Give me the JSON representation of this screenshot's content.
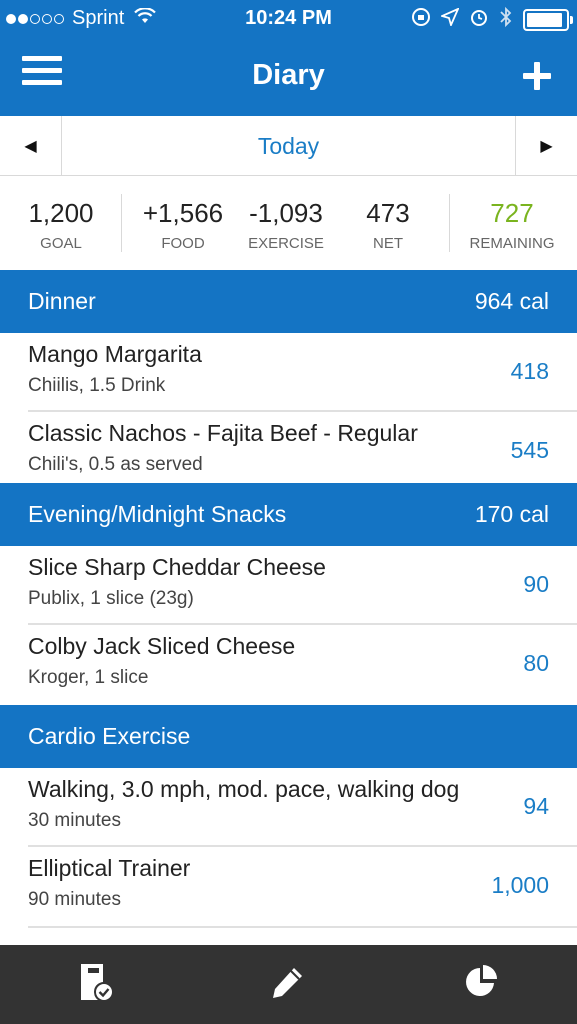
{
  "status_bar": {
    "carrier": "Sprint",
    "time": "10:24 PM"
  },
  "nav": {
    "title": "Diary",
    "menu_icon": "hamburger-menu-icon",
    "add_icon": "plus-icon"
  },
  "date_bar": {
    "prev": "◀",
    "label": "Today",
    "next": "▶"
  },
  "summary": {
    "goal": {
      "value": "1,200",
      "label": "GOAL"
    },
    "food": {
      "value": "+1,566",
      "label": "FOOD"
    },
    "exercise": {
      "value": "-1,093",
      "label": "EXERCISE"
    },
    "net": {
      "value": "473",
      "label": "NET"
    },
    "remaining": {
      "value": "727",
      "label": "REMAINING",
      "color": "#7ab41f"
    }
  },
  "sections": [
    {
      "name": "Dinner",
      "calories": "964 cal",
      "entries": [
        {
          "title": "Mango Margarita",
          "subtitle": "Chiilis, 1.5 Drink",
          "value": "418"
        },
        {
          "title": "Classic Nachos - Fajita Beef - Regular",
          "subtitle": "Chili's, 0.5 as served",
          "value": "545"
        }
      ]
    },
    {
      "name": "Evening/Midnight Snacks",
      "calories": "170 cal",
      "entries": [
        {
          "title": "Slice Sharp Cheddar Cheese",
          "subtitle": "Publix, 1 slice (23g)",
          "value": "90"
        },
        {
          "title": "Colby Jack Sliced Cheese",
          "subtitle": "Kroger, 1 slice",
          "value": "80"
        }
      ]
    },
    {
      "name": "Cardio Exercise",
      "calories": "",
      "entries": [
        {
          "title": "Walking, 3.0 mph, mod. pace, walking dog",
          "subtitle": "30 minutes",
          "value": "94"
        },
        {
          "title": "Elliptical Trainer",
          "subtitle": "90 minutes",
          "value": "1,000"
        }
      ]
    }
  ],
  "tab_bar": {
    "tabs": [
      "diary-checklist-icon",
      "pencil-icon",
      "pie-chart-icon"
    ]
  },
  "colors": {
    "brand_blue": "#1474c4",
    "link_blue": "#1a7dc6",
    "tab_bar": "#333333"
  }
}
